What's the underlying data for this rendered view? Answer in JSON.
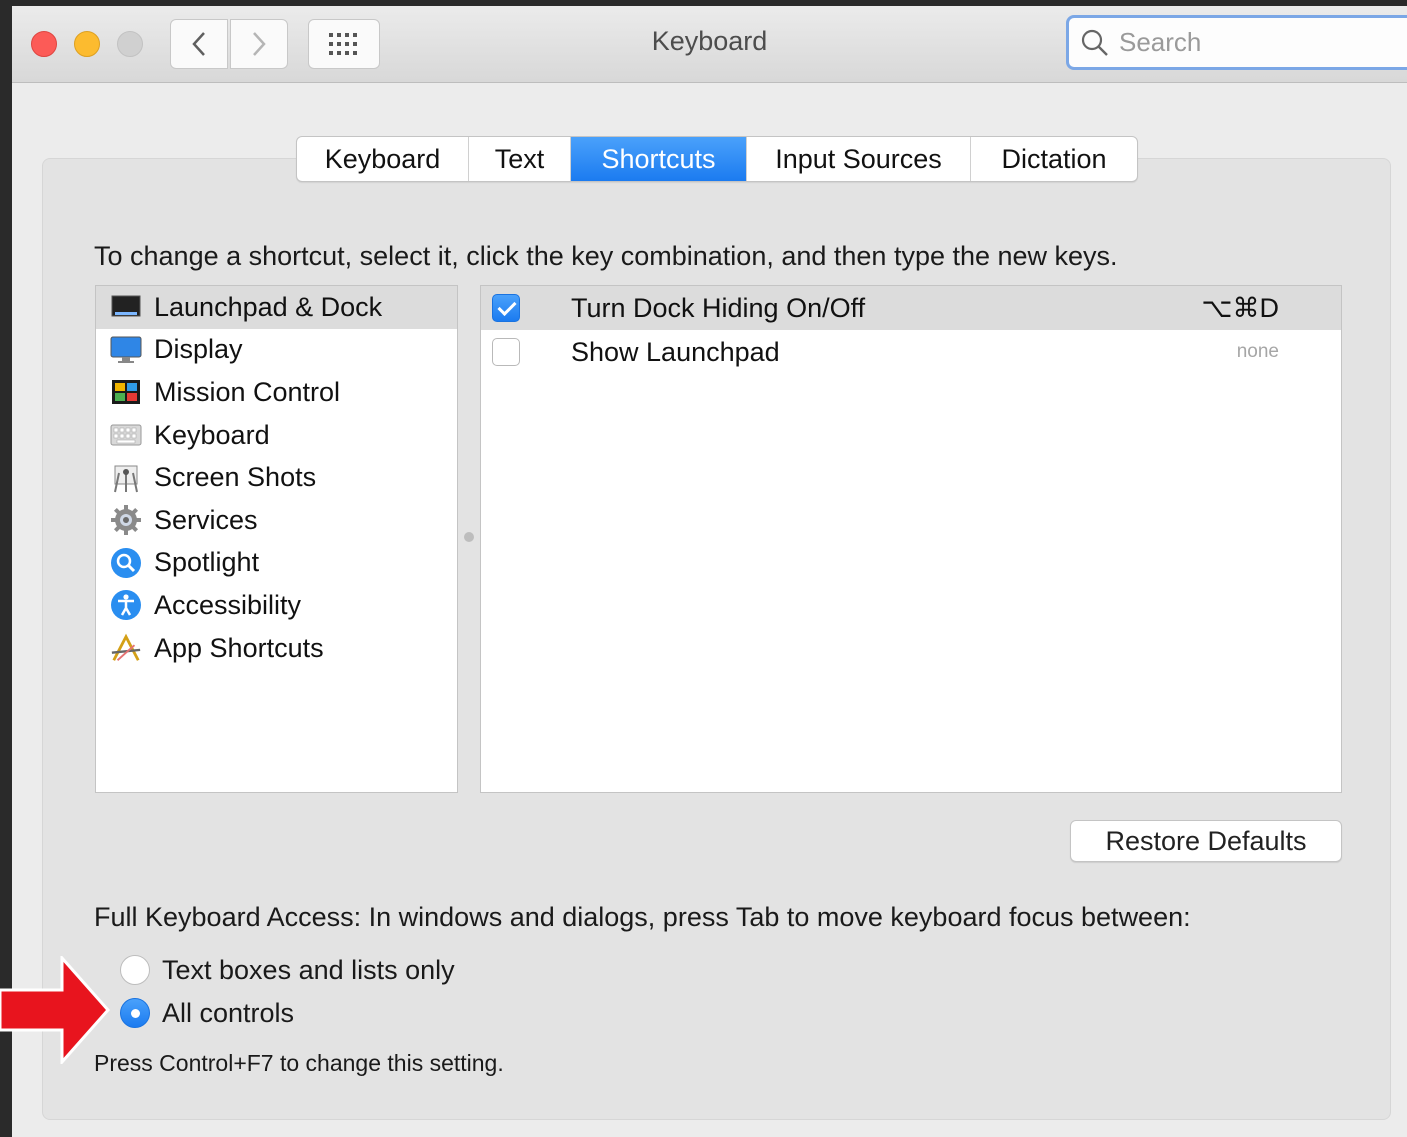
{
  "window": {
    "title": "Keyboard",
    "search_placeholder": "Search"
  },
  "tabs": [
    {
      "label": "Keyboard",
      "active": false
    },
    {
      "label": "Text",
      "active": false
    },
    {
      "label": "Shortcuts",
      "active": true
    },
    {
      "label": "Input Sources",
      "active": false
    },
    {
      "label": "Dictation",
      "active": false
    }
  ],
  "instructions": "To change a shortcut, select it, click the key combination, and then type the new keys.",
  "categories": [
    {
      "label": "Launchpad & Dock",
      "icon": "launchpad-dock-icon",
      "selected": true
    },
    {
      "label": "Display",
      "icon": "display-icon",
      "selected": false
    },
    {
      "label": "Mission Control",
      "icon": "mission-control-icon",
      "selected": false
    },
    {
      "label": "Keyboard",
      "icon": "keyboard-icon",
      "selected": false
    },
    {
      "label": "Screen Shots",
      "icon": "screen-shots-icon",
      "selected": false
    },
    {
      "label": "Services",
      "icon": "gear-icon",
      "selected": false
    },
    {
      "label": "Spotlight",
      "icon": "spotlight-icon",
      "selected": false
    },
    {
      "label": "Accessibility",
      "icon": "accessibility-icon",
      "selected": false
    },
    {
      "label": "App Shortcuts",
      "icon": "app-shortcuts-icon",
      "selected": false
    }
  ],
  "shortcuts": [
    {
      "name": "Turn Dock Hiding On/Off",
      "key": "⌥⌘D",
      "checked": true,
      "selected": true
    },
    {
      "name": "Show Launchpad",
      "key": "none",
      "checked": false,
      "selected": false
    }
  ],
  "restore_button": "Restore Defaults",
  "full_keyboard_access": {
    "label": "Full Keyboard Access: In windows and dialogs, press Tab to move keyboard focus between:",
    "options": [
      {
        "label": "Text boxes and lists only",
        "selected": false
      },
      {
        "label": "All controls",
        "selected": true
      }
    ],
    "hint": "Press Control+F7 to change this setting."
  },
  "colors": {
    "accent": "#1b7bf0",
    "annotation_arrow": "#e8141e"
  }
}
